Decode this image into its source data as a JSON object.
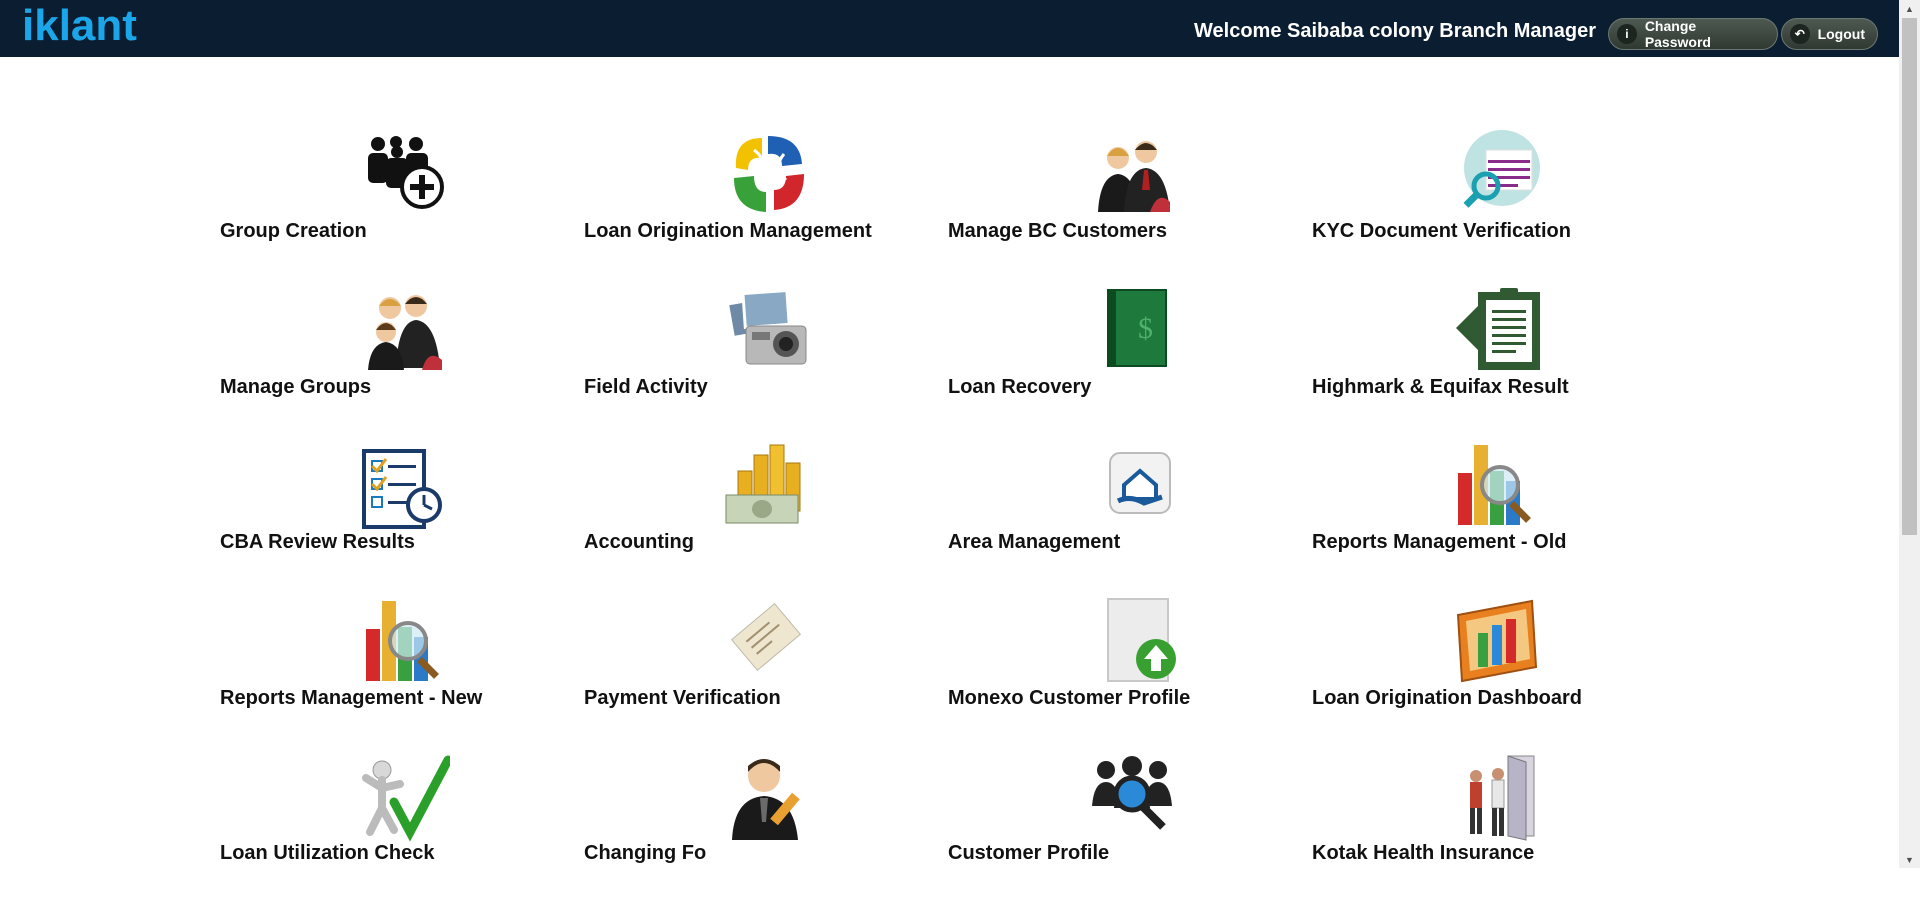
{
  "header": {
    "logo": "iklant",
    "welcome": "Welcome Saibaba colony Branch Manager",
    "change_password_label": "Change Password",
    "logout_label": "Logout"
  },
  "menu": [
    {
      "label": "Group Creation",
      "icon": "group-add-icon"
    },
    {
      "label": "Loan Origination Management",
      "icon": "hands-circle-icon"
    },
    {
      "label": "Manage BC Customers",
      "icon": "people-meeting-icon"
    },
    {
      "label": "KYC Document Verification",
      "icon": "document-search-icon"
    },
    {
      "label": "Manage Groups",
      "icon": "people-group-icon"
    },
    {
      "label": "Field Activity",
      "icon": "camera-photos-icon"
    },
    {
      "label": "Loan Recovery",
      "icon": "money-book-icon"
    },
    {
      "label": "Highmark & Equifax Result",
      "icon": "clipboard-report-icon"
    },
    {
      "label": "CBA Review Results",
      "icon": "checklist-stopwatch-icon"
    },
    {
      "label": "Accounting",
      "icon": "coins-cash-icon"
    },
    {
      "label": "Area Management",
      "icon": "house-hand-icon"
    },
    {
      "label": "Reports Management - Old",
      "icon": "chart-magnifier-icon"
    },
    {
      "label": "Reports Management - New",
      "icon": "chart-magnifier-icon"
    },
    {
      "label": "Payment Verification",
      "icon": "cheque-icon"
    },
    {
      "label": "Monexo Customer Profile",
      "icon": "document-upload-icon"
    },
    {
      "label": "Loan Origination Dashboard",
      "icon": "bar-chart-board-icon"
    },
    {
      "label": "Loan Utilization Check",
      "icon": "person-checkmark-icon"
    },
    {
      "label": "Changing Fo",
      "icon": "person-pencil-icon"
    },
    {
      "label": "Customer Profile",
      "icon": "people-search-icon"
    },
    {
      "label": "Kotak Health Insurance",
      "icon": "people-door-icon"
    }
  ],
  "colors": {
    "header_bg": "#0b1d31",
    "logo": "#1ba6ea",
    "label_text": "#111111"
  }
}
